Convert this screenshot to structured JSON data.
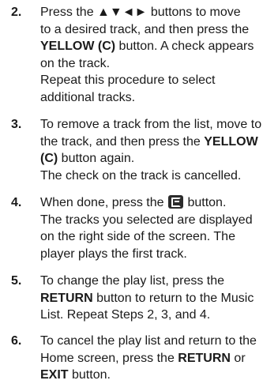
{
  "steps": [
    {
      "number": "2.",
      "lines": [
        "Press the ▲▼◄► buttons to move",
        "to a desired track, and then press the",
        "YELLOW (C) button. A check appears",
        "on the track.",
        "Repeat this procedure to select",
        "additional tracks."
      ]
    },
    {
      "number": "3.",
      "lines": [
        "To remove a track from the list, move to",
        "the track, and then press the YELLOW",
        "(C) button again.",
        "The check on the track is cancelled."
      ]
    },
    {
      "number": "4.",
      "line1_before": "When done, press the",
      "line1_after": "button.",
      "icon": "tools-button-icon",
      "lines": [
        "The tracks you selected are displayed",
        "on the right side of the screen. The",
        "player plays the first track."
      ]
    },
    {
      "number": "5.",
      "lines": [
        "To change the play list, press the",
        "RETURN button to return to the Music",
        "List. Repeat Steps 2, 3, and 4."
      ]
    },
    {
      "number": "6.",
      "lines": [
        "To cancel the play list and return to the",
        "Home screen, press the RETURN or",
        "EXIT button."
      ]
    }
  ],
  "bold_terms": [
    "YELLOW (C)",
    "YELLOW",
    "(C)",
    "RETURN",
    "EXIT"
  ]
}
